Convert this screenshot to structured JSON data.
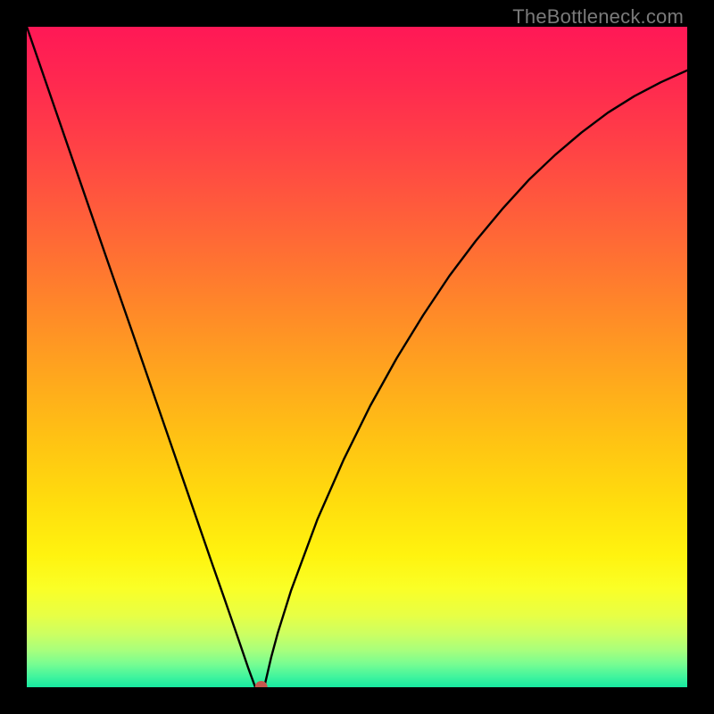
{
  "watermark": "TheBottleneck.com",
  "chart_data": {
    "type": "line",
    "title": "",
    "xlabel": "",
    "ylabel": "",
    "xlim": [
      0,
      100
    ],
    "ylim": [
      0,
      100
    ],
    "grid": false,
    "legend": false,
    "series": [
      {
        "name": "bottleneck-curve",
        "x": [
          0,
          4,
          8,
          12,
          16,
          20,
          24,
          28,
          30,
          32,
          33.5,
          34.6,
          35.5,
          36,
          37,
          38,
          40,
          44,
          48,
          52,
          56,
          60,
          64,
          68,
          72,
          76,
          80,
          84,
          88,
          92,
          96,
          100
        ],
        "y": [
          100,
          88.4,
          76.8,
          65.2,
          53.7,
          42.1,
          30.5,
          18.9,
          13.2,
          7.4,
          3.0,
          0.0,
          0.0,
          0.2,
          4.5,
          8.2,
          14.6,
          25.4,
          34.5,
          42.6,
          49.8,
          56.3,
          62.3,
          67.6,
          72.4,
          76.8,
          80.6,
          84.0,
          87.0,
          89.5,
          91.6,
          93.4
        ]
      }
    ],
    "marker": {
      "name": "optimal-point",
      "x": 35.5,
      "y": 0,
      "color": "#c5584e",
      "radius_px": 7
    },
    "background_gradient": {
      "stops": [
        {
          "pos": 0.0,
          "color": "#ff1856"
        },
        {
          "pos": 0.09,
          "color": "#ff2a4f"
        },
        {
          "pos": 0.18,
          "color": "#ff4146"
        },
        {
          "pos": 0.27,
          "color": "#ff5a3c"
        },
        {
          "pos": 0.36,
          "color": "#ff7431"
        },
        {
          "pos": 0.45,
          "color": "#ff8f26"
        },
        {
          "pos": 0.54,
          "color": "#ffaa1c"
        },
        {
          "pos": 0.63,
          "color": "#ffc413"
        },
        {
          "pos": 0.72,
          "color": "#ffdd0d"
        },
        {
          "pos": 0.8,
          "color": "#fff30f"
        },
        {
          "pos": 0.85,
          "color": "#faff26"
        },
        {
          "pos": 0.89,
          "color": "#e8ff44"
        },
        {
          "pos": 0.92,
          "color": "#ccff62"
        },
        {
          "pos": 0.945,
          "color": "#a6ff7d"
        },
        {
          "pos": 0.965,
          "color": "#77fd92"
        },
        {
          "pos": 0.985,
          "color": "#3ef49e"
        },
        {
          "pos": 1.0,
          "color": "#17e9a0"
        }
      ]
    }
  }
}
